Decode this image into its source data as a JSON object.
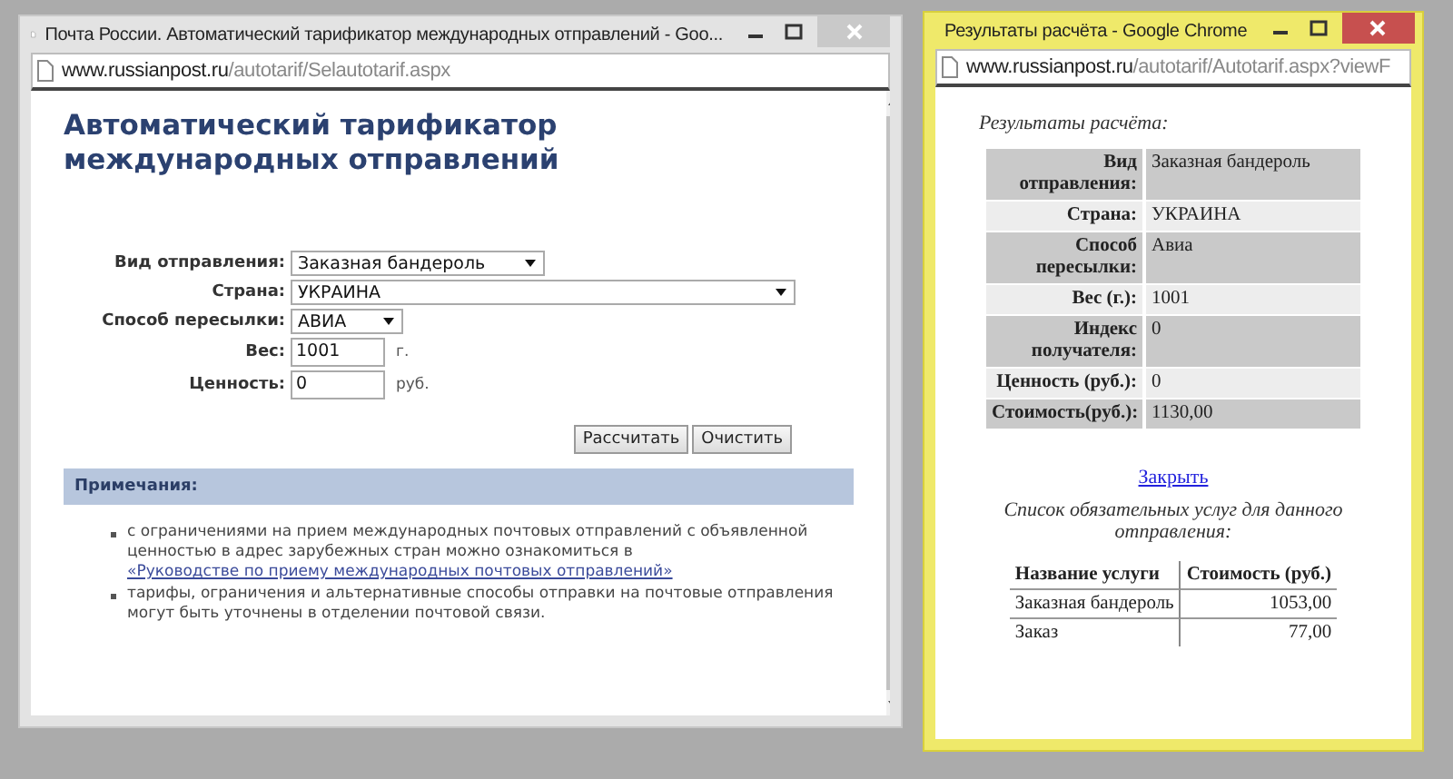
{
  "main_window": {
    "title": "Почта России. Автоматический тарификатор международных отправлений - Goo...",
    "active": false,
    "url_host": "www.russianpost.ru",
    "url_path": "/autotarif/Selautotarif.aspx",
    "heading": "Автоматический тарификатор международных отправлений",
    "fields": [
      {
        "kind": "select",
        "label": "Вид отправления:",
        "value": "Заказная бандероль"
      },
      {
        "kind": "select",
        "label": "Страна:",
        "value": "УКРАИНА"
      },
      {
        "kind": "select",
        "label": "Способ пересылки:",
        "value": "АВИА"
      },
      {
        "kind": "input",
        "label": "Вес:",
        "value": "1001",
        "unit": "г."
      },
      {
        "kind": "input",
        "label": "Ценность:",
        "value": "0",
        "unit": "руб."
      }
    ],
    "buttons": [
      "Рассчитать",
      "Очистить"
    ],
    "notes": {
      "title": "Примечания:",
      "items": [
        {
          "text": "с ограничениями на прием международных почтовых отправлений с объявленной ценностью в адрес зарубежных стран можно ознакомиться в",
          "link": "«Руководстве по приему международных почтовых отправлений»"
        },
        {
          "text": "тарифы, ограничения и альтернативные способы отправки на почтовые отправления могут быть уточнены в отделении почтовой связи."
        }
      ]
    }
  },
  "result_window": {
    "title": "Результаты расчёта - Google Chrome",
    "active": true,
    "url_host": "www.russianpost.ru",
    "url_path": "/autotarif/Autotarif.aspx?viewF",
    "caption": "Результаты расчёта:",
    "rows": [
      {
        "label": "Вид отправления:",
        "value": "Заказная бандероль"
      },
      {
        "label": "Страна:",
        "value": "УКРАИНА"
      },
      {
        "label": "Способ пересылки:",
        "value": "Авиа"
      },
      {
        "label": "Вес (г.):",
        "value": "1001"
      },
      {
        "label": "Индекс получателя:",
        "value": "0"
      },
      {
        "label": "Ценность (руб.):",
        "value": "0"
      },
      {
        "label": "Стоимость(руб.):",
        "value": "1130,00"
      }
    ],
    "close_link": "Закрыть",
    "services_caption": "Список обязательных услуг для данного отправления:",
    "services": {
      "columns": [
        "Название услуги",
        "Стоимость (руб.)"
      ],
      "rows": [
        [
          "Заказная бандероль",
          "1053,00"
        ],
        [
          "Заказ",
          "77,00"
        ]
      ]
    }
  }
}
